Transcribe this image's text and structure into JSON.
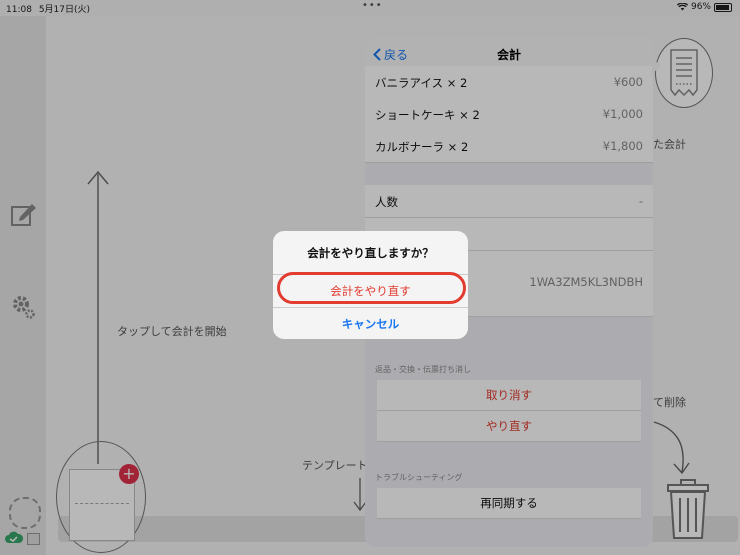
{
  "status": {
    "time": "11:08",
    "date": "5月17日(火)",
    "dots": "•••",
    "battery_text": "96%",
    "battery_level": 0.96
  },
  "canvas": {
    "tap_hint": "タップして会計を開始",
    "template_hint": "テンプレート",
    "receipt_hint_fragment": "た会計",
    "delete_hint_fragment": "て削除"
  },
  "popover": {
    "back_label": "戻る",
    "title": "会計",
    "items": [
      {
        "name": "バニラアイス × 2",
        "price": "¥600"
      },
      {
        "name": "ショートケーキ × 2",
        "price": "¥1,000"
      },
      {
        "name": "カルボナーラ × 2",
        "price": "¥1,800"
      }
    ],
    "people_label": "人数",
    "people_value": "-",
    "code_value": "1WA3ZM5KL3NDBH",
    "section_returns": "返品・交換・伝票打ち消し",
    "cancel_action": "取り消す",
    "redo_action": "やり直す",
    "section_trouble": "トラブルシューティング",
    "resync_action": "再同期する"
  },
  "alert": {
    "title": "会計をやり直しますか？",
    "confirm": "会計をやり直す",
    "cancel": "キャンセル"
  },
  "colors": {
    "destructive": "#e23b2f",
    "accent": "#1976f0",
    "badge": "#e0314c"
  }
}
